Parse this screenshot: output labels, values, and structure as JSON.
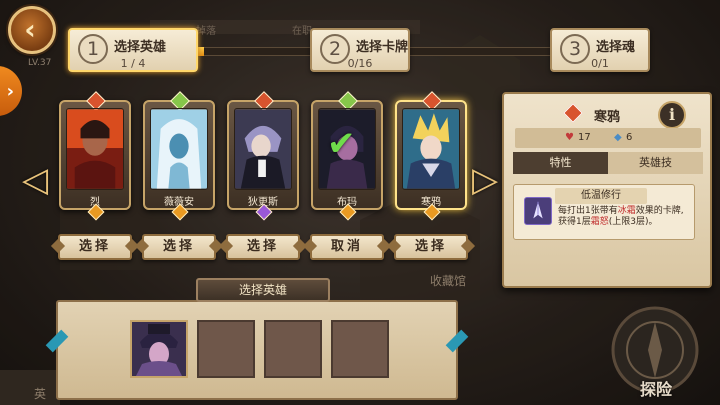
{
  "header": {
    "back_icon": "back-arrow-icon",
    "side_tab_icon": "chevron-right-icon"
  },
  "background": {
    "lv_text": "LV.37",
    "plaza_text": "收藏馆",
    "left_btn_text": "英",
    "bg_label1": "掉落",
    "bg_label2": "在职"
  },
  "steps": [
    {
      "num": "1",
      "title": "选择英雄",
      "count": "1 / 4",
      "active": true
    },
    {
      "num": "2",
      "title": "选择卡牌",
      "count": "0/16",
      "active": false
    },
    {
      "num": "3",
      "title": "选择魂",
      "count": "0/1",
      "active": false
    }
  ],
  "progress": {
    "fraction": 0.12
  },
  "heroes": [
    {
      "name": "烈",
      "action": "选择",
      "top_badge": "sword-badge-icon",
      "badge_color": "#d8542e",
      "gem_color": "#e99a22",
      "selected_in_party": false
    },
    {
      "name": "薇薇安",
      "action": "选择",
      "top_badge": "leaf-badge-icon",
      "badge_color": "#86c64a",
      "gem_color": "#e99a22",
      "selected_in_party": false
    },
    {
      "name": "狄更斯",
      "action": "选择",
      "top_badge": "sword-badge-icon",
      "badge_color": "#d8542e",
      "gem_color": "#9a58d8",
      "selected_in_party": false
    },
    {
      "name": "布玛",
      "action": "取消",
      "top_badge": "leaf-badge-icon",
      "badge_color": "#86c64a",
      "gem_color": "#e99a22",
      "selected_in_party": true
    },
    {
      "name": "寒鸦",
      "action": "选择",
      "top_badge": "sword-badge-icon",
      "badge_color": "#d8542e",
      "gem_color": "#e99a22",
      "selected_in_party": false
    }
  ],
  "nav": {
    "prev_icon": "arrow-left-icon",
    "next_icon": "arrow-right-icon"
  },
  "detail": {
    "hero_name": "寒鸦",
    "class_icon": "sword-class-icon",
    "info_label": "i",
    "hp": "17",
    "energy": "6",
    "hp_icon": "heart-icon",
    "energy_icon": "crystal-icon",
    "tabs": [
      "特性",
      "英雄技"
    ],
    "trait": {
      "name": "低温修行",
      "icon": "ice-shard-icon",
      "desc_pre": "每打出1张带有",
      "desc_hl1": "冰霜",
      "desc_mid": "效果的卡牌,获得1层",
      "desc_hl2": "霜怒",
      "desc_post": "(上限3层)。"
    }
  },
  "party": {
    "banner": "选择英雄",
    "slots": [
      {
        "filled": true,
        "hero": "布玛"
      },
      {
        "filled": false
      },
      {
        "filled": false
      },
      {
        "filled": false
      }
    ]
  },
  "explore_label": "探险"
}
